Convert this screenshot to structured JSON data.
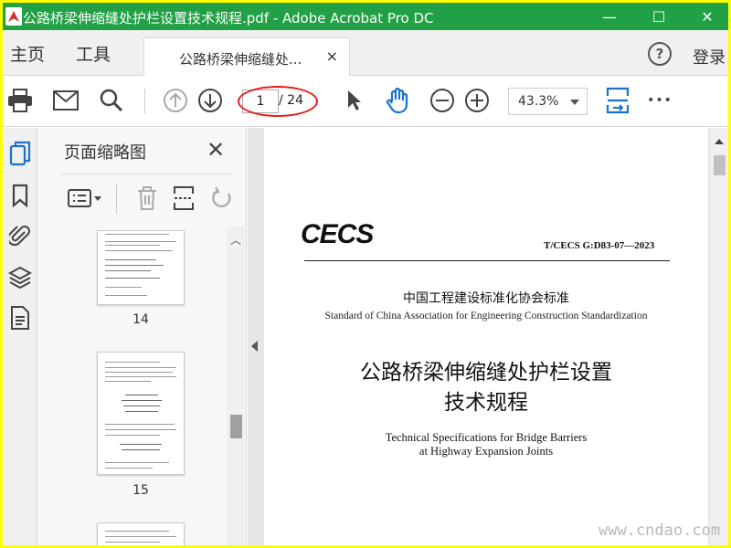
{
  "window": {
    "title": "公路桥梁伸缩缝处护栏设置技术规程.pdf - Adobe Acrobat Pro DC",
    "minimize_glyph": "—",
    "maximize_glyph": "☐",
    "close_glyph": "✕",
    "title_bar_color": "#21a045"
  },
  "menu": {
    "home_label": "主页",
    "tools_label": "工具",
    "doc_tab_label": "公路桥梁伸缩缝处...",
    "doc_tab_close": "×",
    "help_glyph": "?",
    "login_label": "登录"
  },
  "toolbar": {
    "current_page": "1",
    "page_total": "/ 24",
    "zoom_value": "43.3%",
    "more_glyph": "•••",
    "accent_color": "#1a73c8",
    "highlight_oval_color": "#e31b1b"
  },
  "thumbnails_panel": {
    "title": "页面缩略图",
    "close_glyph": "✕",
    "pages": [
      {
        "label": "14"
      },
      {
        "label": "15"
      },
      {
        "label": ""
      }
    ]
  },
  "document": {
    "logo_text": "CECS",
    "standard_code": "T/CECS G:D83-07—2023",
    "org_name_cn": "中国工程建设标准化协会标准",
    "org_name_en": "Standard of China Association for Engineering Construction Standardization",
    "title_cn_line1": "公路桥梁伸缩缝处护栏设置",
    "title_cn_line2": "技术规程",
    "title_en_line1": "Technical Specifications for Bridge Barriers",
    "title_en_line2": "at Highway Expansion Joints"
  },
  "watermark": {
    "text": "www.cndao.com"
  }
}
